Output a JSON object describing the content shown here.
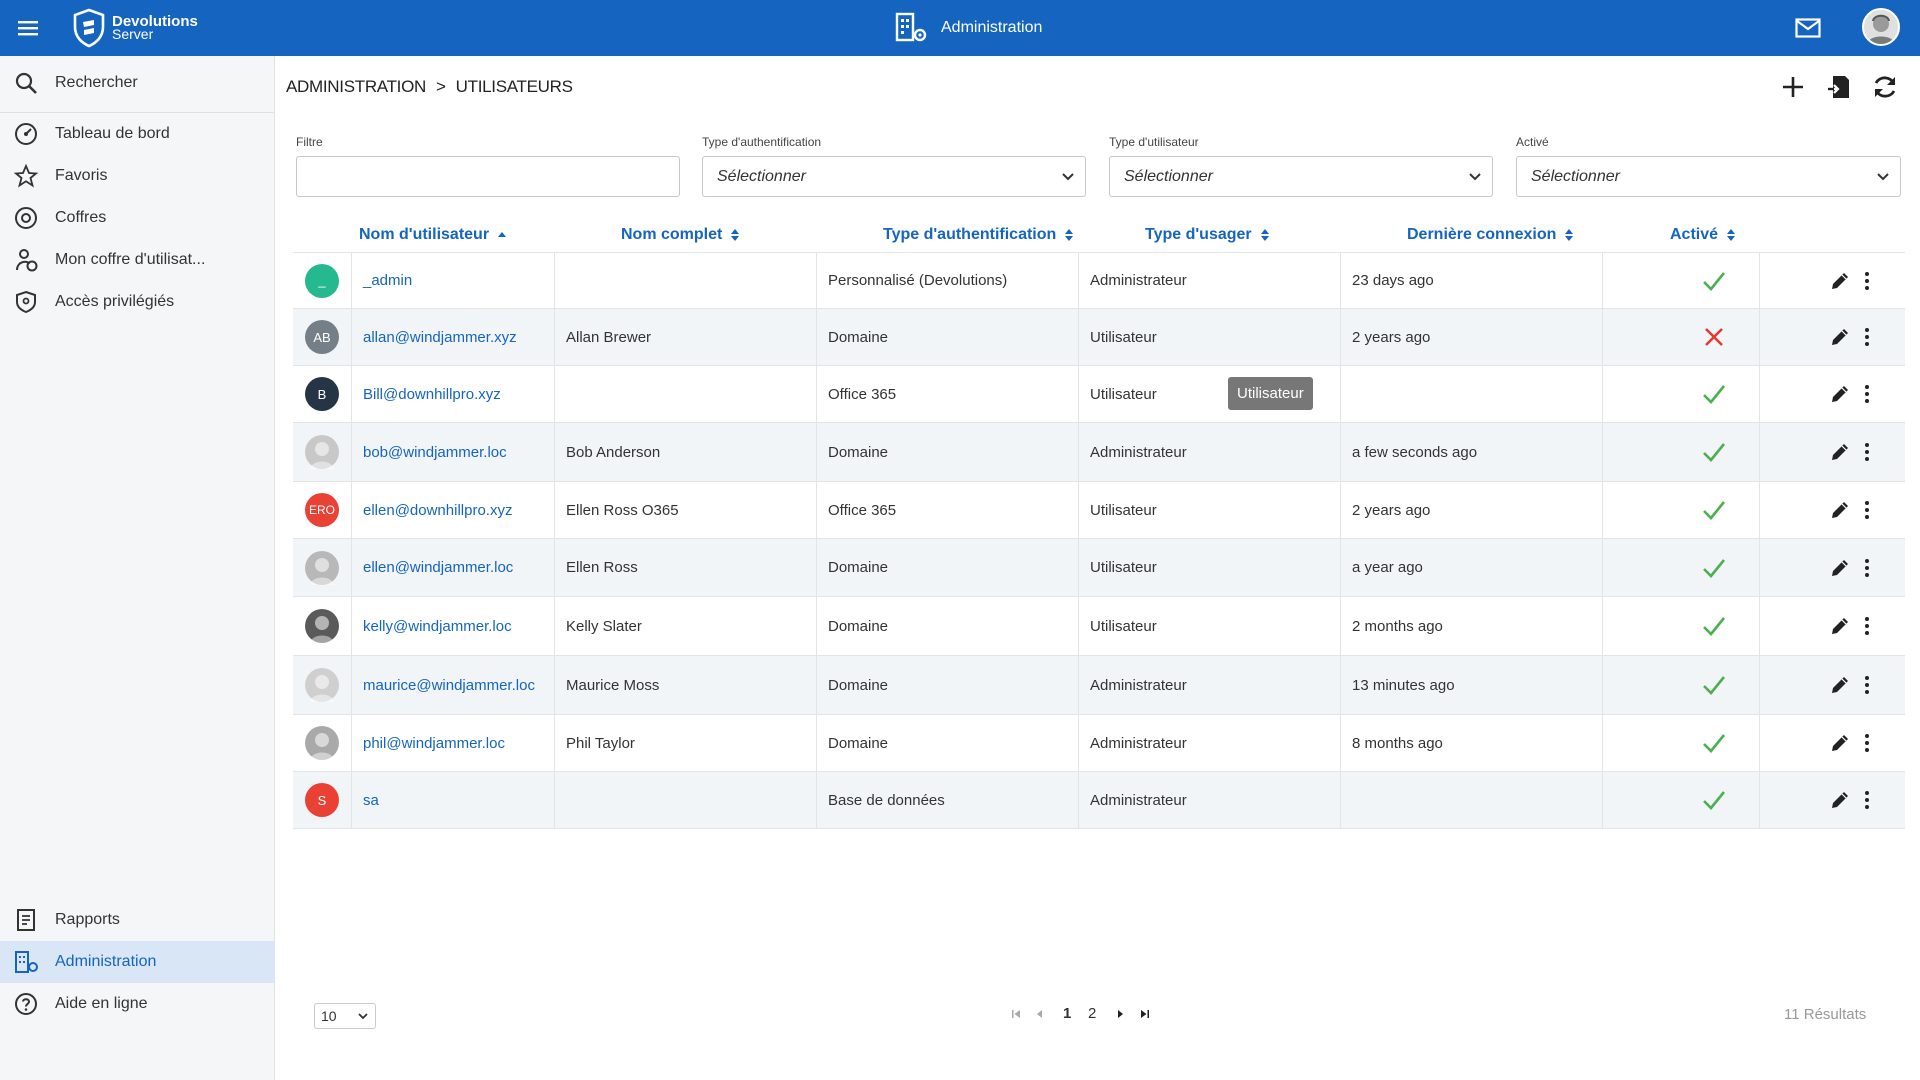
{
  "header": {
    "brand_line1": "Devolutions",
    "brand_line2": "Server",
    "section_title": "Administration",
    "brand_color": "#1565c0"
  },
  "sidebar": {
    "items": [
      {
        "label": "Rechercher",
        "icon": "search-icon"
      },
      {
        "label": "Tableau de bord",
        "icon": "dashboard-icon"
      },
      {
        "label": "Favoris",
        "icon": "star-icon"
      },
      {
        "label": "Coffres",
        "icon": "vault-icon"
      },
      {
        "label": "Mon coffre d'utilisat...",
        "icon": "user-vault-icon"
      },
      {
        "label": "Accès privilégiés",
        "icon": "shield-icon"
      }
    ],
    "bottom_items": [
      {
        "label": "Rapports",
        "icon": "report-icon"
      },
      {
        "label": "Administration",
        "icon": "admin-icon",
        "active": true
      },
      {
        "label": "Aide en ligne",
        "icon": "help-icon"
      }
    ]
  },
  "breadcrumb": {
    "root": "ADMINISTRATION",
    "separator": ">",
    "current": "UTILISATEURS"
  },
  "filters": {
    "filter_label": "Filtre",
    "filter_value": "",
    "auth_type_label": "Type d'authentification",
    "auth_type_value": "Sélectionner",
    "user_type_label": "Type d'utilisateur",
    "user_type_value": "Sélectionner",
    "enabled_label": "Activé",
    "enabled_value": "Sélectionner"
  },
  "table": {
    "columns": [
      "Nom d'utilisateur",
      "Nom complet",
      "Type d'authentification",
      "Type d'usager",
      "Dernière connexion",
      "Activé"
    ],
    "rows": [
      {
        "avatar": "_",
        "avatar_color": "#26b88f",
        "username": "_admin",
        "fullname": "",
        "auth": "Personnalisé (Devolutions)",
        "type": "Administrateur",
        "last": "23 days ago",
        "enabled": true
      },
      {
        "avatar": "AB",
        "avatar_color": "#757f87",
        "username": "allan@windjammer.xyz",
        "fullname": "Allan Brewer",
        "auth": "Domaine",
        "type": "Utilisateur",
        "last": "2 years ago",
        "enabled": false
      },
      {
        "avatar": "B",
        "avatar_color": "#263545",
        "username": "Bill@downhillpro.xyz",
        "fullname": "",
        "auth": "Office 365",
        "type": "Utilisateur",
        "last": "",
        "enabled": true
      },
      {
        "avatar": "",
        "avatar_color": "#c8c8c8",
        "username": "bob@windjammer.loc",
        "fullname": "Bob Anderson",
        "auth": "Domaine",
        "type": "Administrateur",
        "last": "a few seconds ago",
        "enabled": true
      },
      {
        "avatar": "ERO",
        "avatar_color": "#e94235",
        "username": "ellen@downhillpro.xyz",
        "fullname": "Ellen Ross O365",
        "auth": "Office 365",
        "type": "Utilisateur",
        "last": "2 years ago",
        "enabled": true
      },
      {
        "avatar": "",
        "avatar_color": "#b8b8b8",
        "username": "ellen@windjammer.loc",
        "fullname": "Ellen Ross",
        "auth": "Domaine",
        "type": "Utilisateur",
        "last": "a year ago",
        "enabled": true
      },
      {
        "avatar": "",
        "avatar_color": "#5a5a5a",
        "username": "kelly@windjammer.loc",
        "fullname": "Kelly Slater",
        "auth": "Domaine",
        "type": "Utilisateur",
        "last": "2 months ago",
        "enabled": true
      },
      {
        "avatar": "",
        "avatar_color": "#cfcfcf",
        "username": "maurice@windjammer.loc",
        "fullname": "Maurice Moss",
        "auth": "Domaine",
        "type": "Administrateur",
        "last": "13 minutes ago",
        "enabled": true
      },
      {
        "avatar": "",
        "avatar_color": "#a9a9a9",
        "username": "phil@windjammer.loc",
        "fullname": "Phil Taylor",
        "auth": "Domaine",
        "type": "Administrateur",
        "last": "8 months ago",
        "enabled": true
      },
      {
        "avatar": "S",
        "avatar_color": "#e94235",
        "username": "sa",
        "fullname": "",
        "auth": "Base de données",
        "type": "Administrateur",
        "last": "",
        "enabled": true
      }
    ]
  },
  "tooltip": "Utilisateur",
  "footer": {
    "page_size": "10",
    "pages": [
      "1",
      "2"
    ],
    "results": "11 Résultats"
  }
}
